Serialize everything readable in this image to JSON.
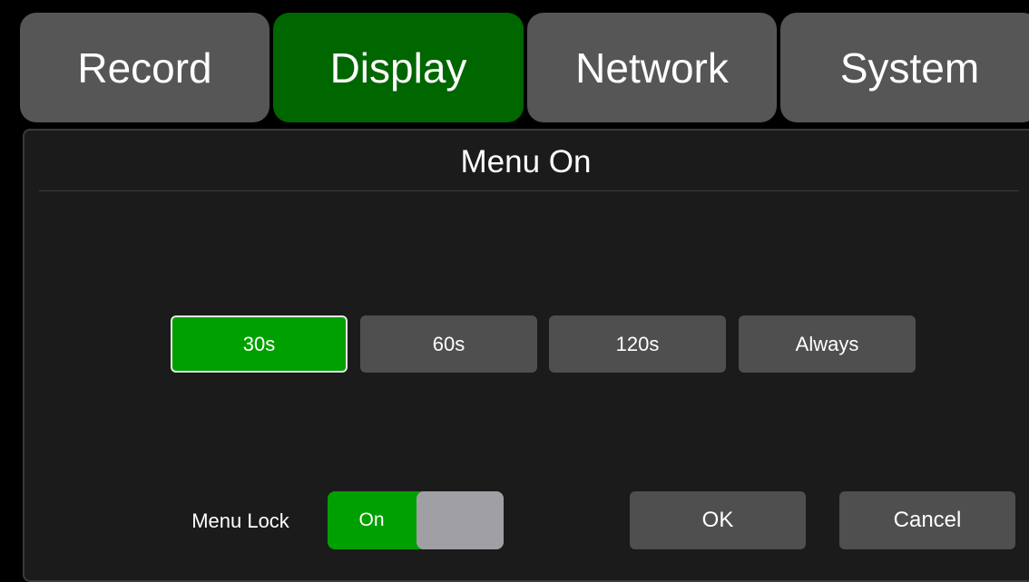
{
  "tabs": [
    {
      "label": "Record",
      "active": false
    },
    {
      "label": "Display",
      "active": true
    },
    {
      "label": "Network",
      "active": false
    },
    {
      "label": "System",
      "active": false
    }
  ],
  "panel": {
    "title": "Menu On"
  },
  "options": [
    {
      "label": "30s",
      "selected": true
    },
    {
      "label": "60s",
      "selected": false
    },
    {
      "label": "120s",
      "selected": false
    },
    {
      "label": "Always",
      "selected": false
    }
  ],
  "menu_lock": {
    "label": "Menu Lock",
    "state": "On"
  },
  "buttons": {
    "ok": "OK",
    "cancel": "Cancel"
  },
  "colors": {
    "active_tab": "#006600",
    "selected_option": "#00a000",
    "inactive": "#565656",
    "background": "#000000"
  }
}
